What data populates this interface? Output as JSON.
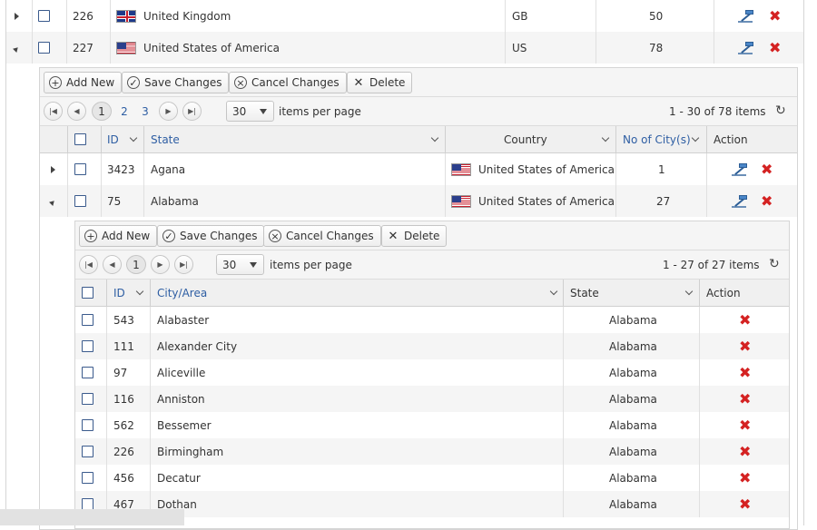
{
  "top_rows": [
    {
      "id": "226",
      "country": "United Kingdom",
      "code": "GB",
      "count": "50",
      "flag": "uk-flag"
    },
    {
      "id": "227",
      "country": "United States of America",
      "code": "US",
      "count": "78",
      "flag": "us-flag"
    }
  ],
  "toolbar1": {
    "add": "Add New",
    "save": "Save Changes",
    "cancel": "Cancel Changes",
    "delete": "Delete"
  },
  "pager1": {
    "pages": [
      "1",
      "2",
      "3"
    ],
    "page_size": "30",
    "items_per_page": "items per page",
    "summary": "1 - 30 of 78 items"
  },
  "state_grid": {
    "headers": {
      "id": "ID",
      "state": "State",
      "country": "Country",
      "cities": "No of City(s)",
      "action": "Action"
    },
    "rows": [
      {
        "id": "3423",
        "state": "Agana",
        "country": "United States of America",
        "cities": "1"
      },
      {
        "id": "75",
        "state": "Alabama",
        "country": "United States of America",
        "cities": "27"
      }
    ]
  },
  "toolbar2": {
    "add": "Add New",
    "save": "Save Changes",
    "cancel": "Cancel Changes",
    "delete": "Delete"
  },
  "pager2": {
    "pages": [
      "1"
    ],
    "page_size": "30",
    "items_per_page": "items per page",
    "summary": "1 - 27 of 27 items"
  },
  "city_grid": {
    "headers": {
      "id": "ID",
      "city": "City/Area",
      "state": "State",
      "action": "Action"
    },
    "rows": [
      {
        "id": "543",
        "city": "Alabaster",
        "state": "Alabama"
      },
      {
        "id": "111",
        "city": "Alexander City",
        "state": "Alabama"
      },
      {
        "id": "97",
        "city": "Aliceville",
        "state": "Alabama"
      },
      {
        "id": "116",
        "city": "Anniston",
        "state": "Alabama"
      },
      {
        "id": "562",
        "city": "Bessemer",
        "state": "Alabama"
      },
      {
        "id": "226",
        "city": "Birmingham",
        "state": "Alabama"
      },
      {
        "id": "456",
        "city": "Decatur",
        "state": "Alabama"
      },
      {
        "id": "467",
        "city": "Dothan",
        "state": "Alabama"
      }
    ]
  },
  "colors": {
    "link": "#2e5ea3",
    "delete": "#d42222",
    "header_bg": "#f0f0f0",
    "alt_row": "#f5f5f5"
  }
}
